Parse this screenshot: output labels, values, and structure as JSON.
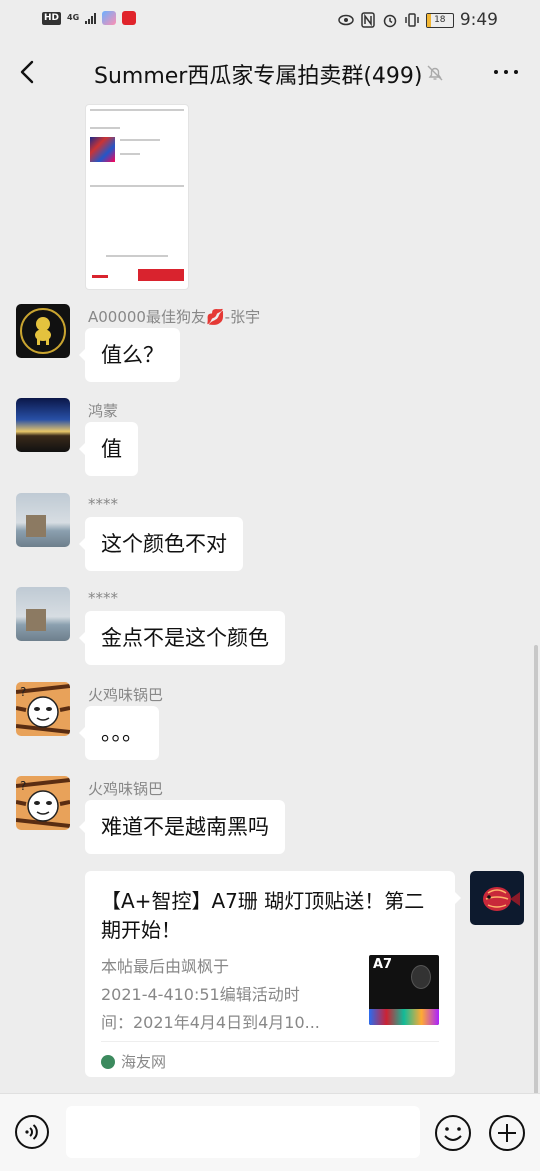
{
  "status_bar": {
    "hd": "HD",
    "network": "4G",
    "battery": "18",
    "battery_level": 0.18,
    "time": "9:49"
  },
  "nav": {
    "title": "Summer西瓜家专属拍卖群(499)"
  },
  "messages": [
    {
      "sender": "A00000最佳狗友💋-张宇",
      "text": "值么？"
    },
    {
      "sender": "鸿蒙",
      "text": "值"
    },
    {
      "sender": "****",
      "text": "这个颜色不对"
    },
    {
      "sender": "****",
      "text": "金点不是这个颜色"
    },
    {
      "sender": "火鸡味锅巴",
      "text": "。。。"
    },
    {
      "sender": "火鸡味锅巴",
      "text": "难道不是越南黑吗"
    }
  ],
  "link_card": {
    "title": "【A+智控】A7珊 瑚灯顶贴送！第二期开始！",
    "desc_lines": [
      "本帖最后由飒枫于",
      "2021-4-410:51编辑活动时",
      "间：2021年4月4日到4月10..."
    ],
    "thumb_label": "A7",
    "source": "海友网"
  },
  "icons": {
    "back": "back-arrow-icon",
    "mute": "bell-off-icon",
    "more": "more-dots-icon",
    "voice": "voice-icon",
    "emoji": "emoji-icon",
    "plus": "plus-icon"
  },
  "colors": {
    "background": "#ededed",
    "bubble": "#ffffff",
    "secondary_text": "#888888"
  }
}
